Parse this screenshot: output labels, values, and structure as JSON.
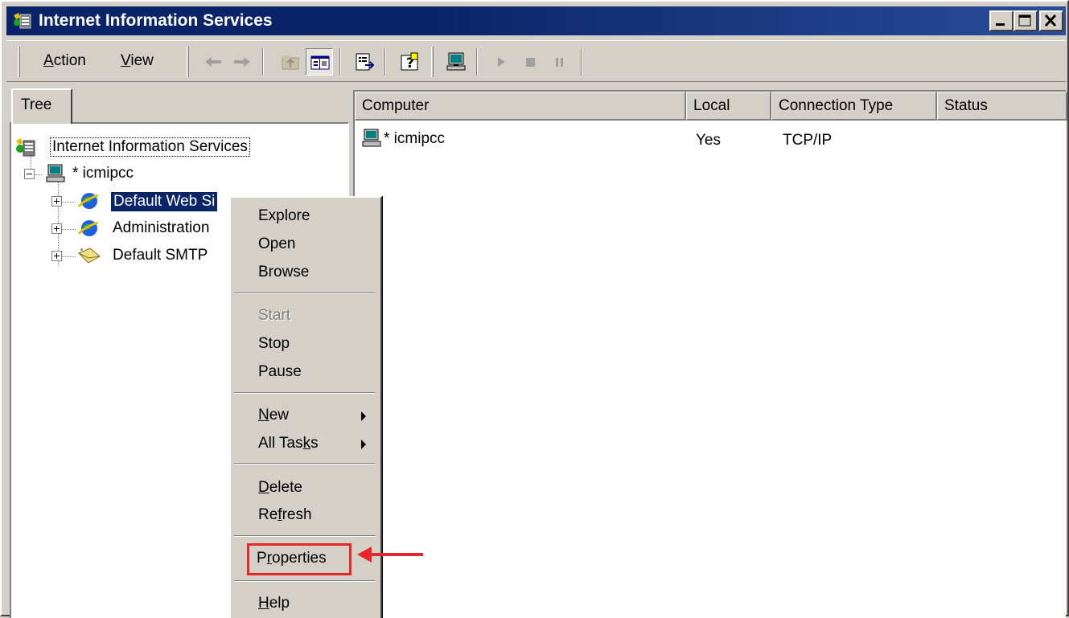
{
  "window": {
    "title": "Internet Information Services",
    "controls": [
      "minimize",
      "maximize",
      "close"
    ]
  },
  "toolbar": {
    "menus": [
      {
        "label": "Action",
        "mnemonic": "A",
        "rest": "ction"
      },
      {
        "label": "View",
        "mnemonic": "V",
        "rest": "iew"
      }
    ],
    "buttons": [
      "back-icon",
      "forward-icon",
      "up-folder-icon",
      "show-tree-icon",
      "export-list-icon",
      "help-icon",
      "computer-icon",
      "play-icon",
      "stop-icon",
      "pause-icon"
    ]
  },
  "tree": {
    "tab_label": "Tree",
    "root_label": "Internet Information Services",
    "computer_label": "* icmipcc",
    "items": [
      {
        "label": "Default Web Si",
        "selected": true,
        "icon": "globe-icon"
      },
      {
        "label": "Administration",
        "selected": false,
        "icon": "globe-icon"
      },
      {
        "label": "Default SMTP",
        "selected": false,
        "icon": "smtp-icon"
      }
    ]
  },
  "list": {
    "columns": [
      "Computer",
      "Local",
      "Connection Type",
      "Status"
    ],
    "rows": [
      {
        "computer": "* icmipcc",
        "local": "Yes",
        "connection_type": "TCP/IP",
        "status": ""
      }
    ]
  },
  "context_menu": {
    "items": {
      "explore": "Explore",
      "open": "Open",
      "browse": "Browse",
      "start": "Start",
      "stop": "Stop",
      "pause": "Pause",
      "new": {
        "mn": "N",
        "rest": "ew"
      },
      "all_tasks": {
        "pre": "All Tas",
        "mn": "k",
        "rest": "s"
      },
      "delete": {
        "mn": "D",
        "rest": "elete"
      },
      "refresh": {
        "pre": "Re",
        "mn": "f",
        "rest": "resh"
      },
      "properties": {
        "pre": "P",
        "mn": "r",
        "rest": "operties"
      },
      "help": {
        "mn": "H",
        "rest": "elp"
      }
    }
  },
  "colors": {
    "title_bar": "#0a246a",
    "face": "#d4d0c8",
    "selection": "#0a246a",
    "annotation": "#e8262a"
  }
}
